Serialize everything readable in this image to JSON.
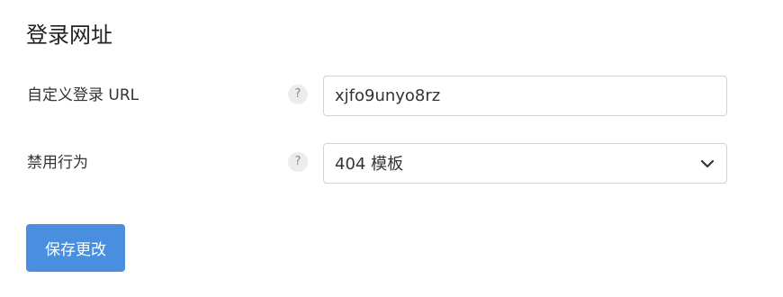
{
  "section": {
    "title": "登录网址"
  },
  "fields": {
    "custom_login_url": {
      "label": "自定义登录 URL",
      "value": "xjfo9unyo8rz",
      "help_icon": "question-mark",
      "help_symbol": "?"
    },
    "disabled_behavior": {
      "label": "禁用行为",
      "selected": "404 模板",
      "help_icon": "question-mark",
      "help_symbol": "?",
      "dropdown_icon": "chevron-down"
    }
  },
  "actions": {
    "save_label": "保存更改"
  },
  "colors": {
    "button_background": "#4a8fdf",
    "button_text": "#ffffff",
    "input_border": "#cfd4d9",
    "help_icon_background": "#ececec"
  }
}
